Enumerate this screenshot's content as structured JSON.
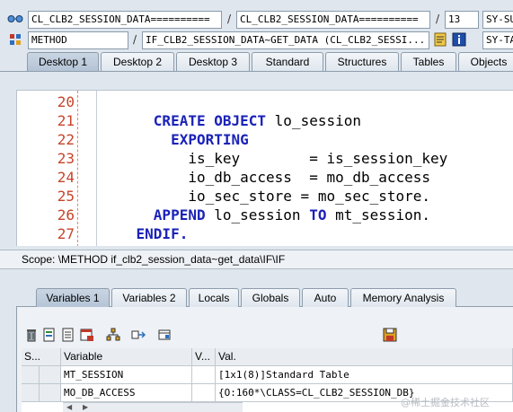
{
  "toolbar1": {
    "program_field": "CL_CLB2_SESSION_DATA==========",
    "include_field": "CL_CLB2_SESSION_DATA==========",
    "line_field": "13",
    "subrc_field": "SY-SU"
  },
  "toolbar2": {
    "event_type_field": "METHOD",
    "event_field": "IF_CLB2_SESSION_DATA~GET_DATA (CL_CLB2_SESSI...",
    "tabix_field": "SY-TA"
  },
  "desktop_tabs": [
    "Desktop 1",
    "Desktop 2",
    "Desktop 3",
    "Standard",
    "Structures",
    "Tables",
    "Objects"
  ],
  "code": {
    "lines": [
      {
        "num": "20",
        "parts": []
      },
      {
        "num": "21",
        "parts": [
          {
            "t": "      ",
            "k": false
          },
          {
            "t": "CREATE OBJECT",
            "k": true
          },
          {
            "t": " lo_session",
            "k": false
          }
        ]
      },
      {
        "num": "22",
        "parts": [
          {
            "t": "        ",
            "k": false
          },
          {
            "t": "EXPORTING",
            "k": true
          }
        ]
      },
      {
        "num": "23",
        "parts": [
          {
            "t": "          is_key        = is_session_key",
            "k": false
          }
        ]
      },
      {
        "num": "24",
        "parts": [
          {
            "t": "          io_db_access  = mo_db_access",
            "k": false
          }
        ]
      },
      {
        "num": "25",
        "parts": [
          {
            "t": "          io_sec_store = mo_sec_store.",
            "k": false
          }
        ]
      },
      {
        "num": "26",
        "parts": [
          {
            "t": "      ",
            "k": false
          },
          {
            "t": "APPEND",
            "k": true
          },
          {
            "t": " lo_session ",
            "k": false
          },
          {
            "t": "TO",
            "k": true
          },
          {
            "t": " mt_session.",
            "k": false
          }
        ]
      },
      {
        "num": "27",
        "parts": [
          {
            "t": "    ",
            "k": false
          },
          {
            "t": "ENDIF.",
            "k": true
          }
        ]
      }
    ]
  },
  "scope_text": "Scope: \\METHOD if_clb2_session_data~get_data\\IF\\IF",
  "variable_tabs": [
    "Variables 1",
    "Variables 2",
    "Locals",
    "Globals",
    "Auto",
    "Memory Analysis"
  ],
  "grid": {
    "headers": {
      "s": "S...",
      "variable": "Variable",
      "v": "V...",
      "val": "Val."
    },
    "rows": [
      {
        "variable": "MT_SESSION",
        "val": "[1x1(8)]Standard Table"
      },
      {
        "variable": "MO_DB_ACCESS",
        "val": "{O:160*\\CLASS=CL_CLB2_SESSION_DB}"
      }
    ]
  },
  "watermark": "@稀土掘金技术社区",
  "colors": {
    "keyword": "#1a22b8",
    "line_number": "#c8442a",
    "active_tab": "#b4c4d6"
  }
}
